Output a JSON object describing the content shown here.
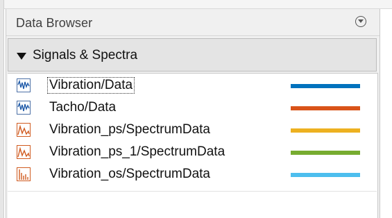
{
  "panel": {
    "title": "Data Browser",
    "menu_icon": "circle-down-caret-icon"
  },
  "section": {
    "title": "Signals & Spectra",
    "expanded": true,
    "caret_icon": "triangle-down-icon"
  },
  "signals": [
    {
      "label": "Vibration/Data",
      "icon": "time-signal-icon",
      "color": "#0072bd",
      "focused": true
    },
    {
      "label": "Tacho/Data",
      "icon": "time-signal-icon",
      "color": "#d95319",
      "focused": false
    },
    {
      "label": "Vibration_ps/SpectrumData",
      "icon": "power-spectrum-icon",
      "color": "#edb120",
      "focused": false
    },
    {
      "label": "Vibration_ps_1/SpectrumData",
      "icon": "power-spectrum-icon",
      "color": "#77ac30",
      "focused": false
    },
    {
      "label": "Vibration_os/SpectrumData",
      "icon": "order-spectrum-icon",
      "color": "#4dbeee",
      "focused": false
    }
  ]
}
